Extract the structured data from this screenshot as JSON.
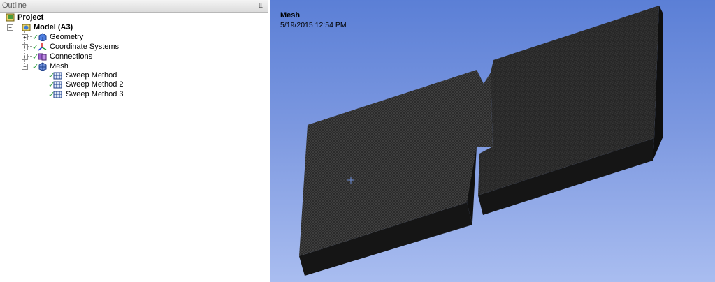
{
  "outline": {
    "title": "Outline",
    "pin_icon": "pin-icon",
    "tree": {
      "project": "Project",
      "model": "Model (A3)",
      "geometry": "Geometry",
      "coordinate_systems": "Coordinate Systems",
      "connections": "Connections",
      "mesh": "Mesh",
      "sweep_1": "Sweep Method",
      "sweep_2": "Sweep Method 2",
      "sweep_3": "Sweep Method 3"
    }
  },
  "viewport": {
    "title": "Mesh",
    "date": "5/19/2015 12:54 PM"
  },
  "colors": {
    "check_green": "#1f9a2f",
    "bg_top": "#5b7fd6",
    "bg_bottom": "#a9bdf0",
    "mesh_dark": "#2a2a2a"
  }
}
